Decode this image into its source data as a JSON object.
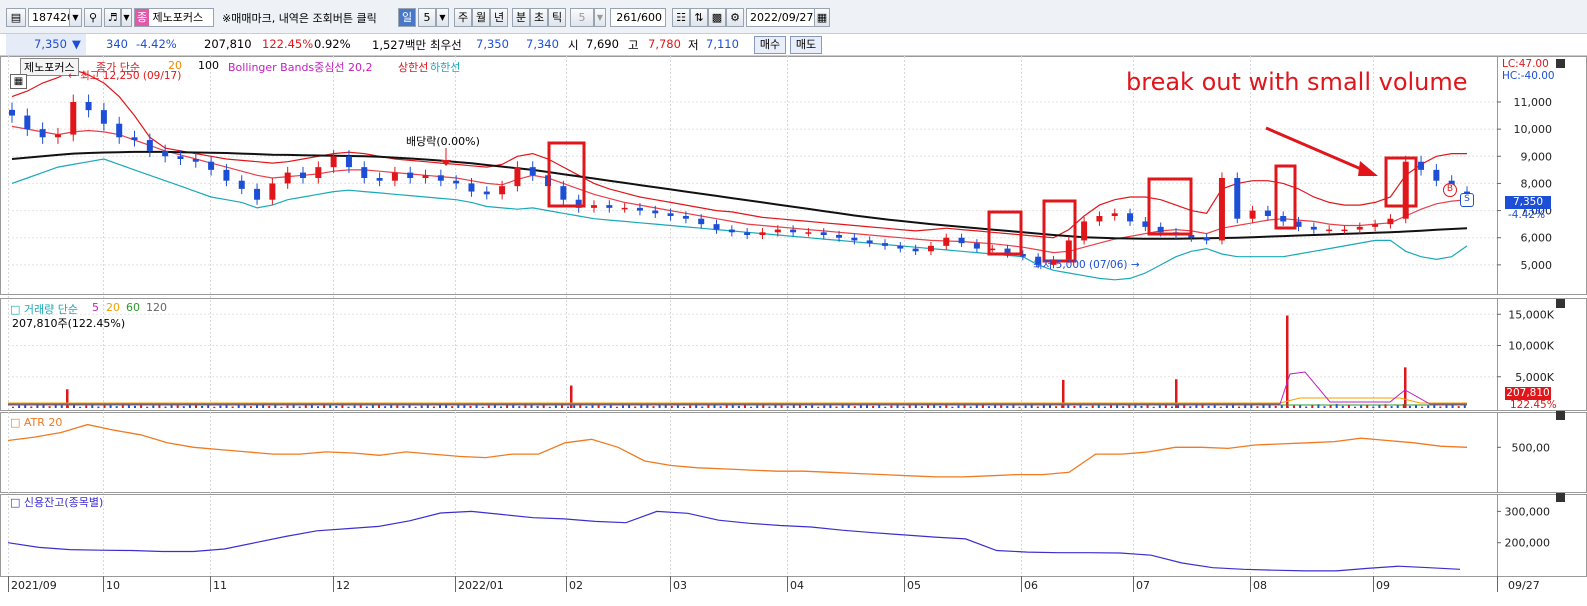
{
  "toolbar": {
    "stock_code": "187420",
    "stock_name_badge": "종",
    "stock_name": "제노포커스",
    "notice": "※매매마크, 내역은 조회버튼 클릭",
    "period_buttons": [
      "일",
      "5",
      "주",
      "월",
      "년",
      "분",
      "초",
      "틱",
      "5"
    ],
    "count": "261/600",
    "date": "2022/09/27"
  },
  "quote": {
    "price": "7,350",
    "change_arrow": "▼",
    "change": "340",
    "change_pct": "-4.42%",
    "volume": "207,810",
    "volume_pct": "122.45%",
    "turnover": "0.92%",
    "amount": "1,527백만",
    "best_label": "최우선",
    "best_ask": "7,350",
    "best_bid": "7,340",
    "open_label": "시",
    "open": "7,690",
    "high_label": "고",
    "high": "7,780",
    "low_label": "저",
    "low": "7,110",
    "buy_label": "매수",
    "sell_label": "매도"
  },
  "price_panel": {
    "stock_tag": "제노포커스",
    "ma_label": "종가 단순",
    "ma_periods": [
      "20",
      "100"
    ],
    "bb_label": "Bollinger Bands중심선 20,2",
    "upper_label": "상한선",
    "lower_label": "하한선",
    "high_marker": "최고 12,250 (09/17)",
    "low_marker": "최저 5,000 (07/06)",
    "dividend_marker": "배당락(0.00%)",
    "annotation": "break out with small volume",
    "lc": "LC:47.00",
    "hc": "HC:-40.00",
    "price_tag": "7,350",
    "price_tag_pct": "-4.42%",
    "signal_b": "B",
    "signal_s": "S"
  },
  "volume_panel": {
    "title": "거래량 단순",
    "periods": [
      "5",
      "20",
      "60",
      "120"
    ],
    "current": "207,810주(122.45%)",
    "tag": "207,810",
    "tag_pct": "122.45%"
  },
  "atr_panel": {
    "title": "ATR 20"
  },
  "credit_panel": {
    "title": "신용잔고(종목별)"
  },
  "x_axis": [
    "2021/09",
    "10",
    "11",
    "12",
    "2022/01",
    "02",
    "03",
    "04",
    "05",
    "06",
    "07",
    "08",
    "09"
  ],
  "x_axis_end": "09/27",
  "colors": {
    "up": "#e0161b",
    "down": "#1d4fd6",
    "ma20": "#e8404a",
    "ma100": "#111111",
    "bb_upper": "#e0161b",
    "bb_lower": "#1aa9b8",
    "atr": "#f07a22",
    "credit": "#3b2fd0",
    "annotation": "#e0161b"
  },
  "chart_data": [
    {
      "type": "candlestick",
      "title": "제노포커스",
      "y_ticks": [
        5000,
        6000,
        7000,
        8000,
        9000,
        10000,
        11000
      ],
      "ylim": [
        4000,
        12400
      ],
      "x_months": [
        "2021/09",
        "10",
        "11",
        "12",
        "2022/01",
        "02",
        "03",
        "04",
        "05",
        "06",
        "07",
        "08",
        "09"
      ],
      "series": [
        {
          "name": "종가",
          "values": [
            10500,
            10000,
            9700,
            9800,
            11000,
            10700,
            10200,
            9700,
            9600,
            9200,
            9000,
            8900,
            8800,
            8500,
            8100,
            7800,
            7400,
            8000,
            8400,
            8200,
            8600,
            9000,
            8600,
            8200,
            8100,
            8400,
            8200,
            8300,
            8100,
            8000,
            7700,
            7600,
            7900,
            8600,
            8300,
            7900,
            7400,
            7100,
            7200,
            7100,
            7100,
            7000,
            6900,
            6800,
            6700,
            6500,
            6300,
            6200,
            6100,
            6200,
            6300,
            6200,
            6200,
            6100,
            6000,
            5900,
            5800,
            5700,
            5600,
            5500,
            5700,
            6000,
            5800,
            5600,
            5600,
            5400,
            5300,
            5000,
            5200,
            5900,
            6600,
            6800,
            6900,
            6600,
            6400,
            6200,
            6100,
            6000,
            5900,
            8200,
            6700,
            7000,
            6800,
            6600,
            6400,
            6300,
            6300,
            6300,
            6400,
            6500,
            6700,
            8800,
            8500,
            8100,
            7700,
            7350
          ]
        },
        {
          "name": "20",
          "values": [
            10100,
            10000,
            9900,
            9800,
            9900,
            9950,
            9900,
            9800,
            9600,
            9400,
            9200,
            9050,
            8900,
            8750,
            8600,
            8450,
            8300,
            8200,
            8250,
            8300,
            8350,
            8450,
            8500,
            8500,
            8450,
            8400,
            8350,
            8300,
            8250,
            8200,
            8100,
            8000,
            7950,
            8150,
            8300,
            8200,
            8000,
            7800,
            7600,
            7450,
            7300,
            7200,
            7100,
            7000,
            6900,
            6800,
            6700,
            6600,
            6500,
            6450,
            6400,
            6350,
            6300,
            6250,
            6200,
            6150,
            6100,
            6050,
            6000,
            5950,
            5900,
            5880,
            5860,
            5820,
            5780,
            5720,
            5650,
            5550,
            5450,
            5500,
            5650,
            5800,
            5950,
            6050,
            6150,
            6250,
            6300,
            6250,
            6150,
            6350,
            6450,
            6550,
            6650,
            6700,
            6650,
            6600,
            6500,
            6450,
            6450,
            6500,
            6550,
            6800,
            7050,
            7250,
            7350,
            7400
          ]
        },
        {
          "name": "100",
          "values": [
            8900,
            8950,
            9000,
            9050,
            9100,
            9120,
            9140,
            9150,
            9160,
            9160,
            9160,
            9150,
            9140,
            9130,
            9120,
            9100,
            9080,
            9060,
            9050,
            9040,
            9030,
            9020,
            9010,
            9000,
            8980,
            8950,
            8920,
            8880,
            8840,
            8790,
            8740,
            8680,
            8620,
            8560,
            8500,
            8420,
            8340,
            8260,
            8180,
            8100,
            8020,
            7940,
            7860,
            7780,
            7700,
            7620,
            7540,
            7460,
            7380,
            7300,
            7220,
            7140,
            7060,
            6980,
            6900,
            6820,
            6750,
            6680,
            6620,
            6560,
            6500,
            6450,
            6400,
            6350,
            6300,
            6250,
            6200,
            6150,
            6100,
            6060,
            6020,
            6000,
            5980,
            5970,
            5960,
            5960,
            5960,
            5970,
            5980,
            5990,
            6000,
            6020,
            6040,
            6060,
            6080,
            6100,
            6120,
            6140,
            6160,
            6180,
            6200,
            6230,
            6260,
            6290,
            6320,
            6350
          ]
        },
        {
          "name": "상한선",
          "values": [
            11200,
            11400,
            11700,
            11900,
            12200,
            12000,
            11700,
            11200,
            10500,
            9700,
            9300,
            9200,
            9100,
            9000,
            8900,
            8850,
            8800,
            8750,
            8800,
            8900,
            9000,
            9100,
            9150,
            9100,
            9000,
            8900,
            8850,
            8800,
            8750,
            8700,
            8650,
            8600,
            8700,
            9000,
            9100,
            8900,
            8600,
            8300,
            8000,
            7800,
            7650,
            7500,
            7400,
            7300,
            7200,
            7100,
            7000,
            6950,
            6850,
            6750,
            6700,
            6650,
            6600,
            6550,
            6500,
            6450,
            6400,
            6350,
            6300,
            6250,
            6300,
            6350,
            6300,
            6250,
            6200,
            6150,
            6100,
            6050,
            6000,
            6300,
            6800,
            7200,
            7400,
            7500,
            7500,
            7400,
            7200,
            7000,
            6900,
            7800,
            8000,
            8100,
            8100,
            8000,
            7800,
            7500,
            7300,
            7200,
            7200,
            7300,
            7500,
            8300,
            8700,
            9000,
            9100,
            9100
          ]
        },
        {
          "name": "하한선",
          "values": [
            8000,
            8200,
            8400,
            8600,
            8700,
            8800,
            8900,
            8700,
            8500,
            8300,
            8100,
            7900,
            7700,
            7500,
            7400,
            7300,
            7100,
            7200,
            7400,
            7500,
            7600,
            7700,
            7750,
            7700,
            7650,
            7600,
            7550,
            7500,
            7450,
            7400,
            7300,
            7150,
            7100,
            7050,
            7100,
            7000,
            6900,
            6800,
            6700,
            6650,
            6600,
            6550,
            6500,
            6450,
            6400,
            6350,
            6300,
            6250,
            6200,
            6150,
            6100,
            6050,
            6000,
            5950,
            5900,
            5850,
            5800,
            5750,
            5700,
            5650,
            5600,
            5550,
            5500,
            5450,
            5400,
            5350,
            5300,
            5000,
            4800,
            4700,
            4600,
            4500,
            4450,
            4500,
            4700,
            5000,
            5300,
            5500,
            5600,
            5400,
            5300,
            5300,
            5300,
            5300,
            5400,
            5500,
            5600,
            5700,
            5800,
            5900,
            5900,
            5500,
            5300,
            5200,
            5300,
            5700
          ]
        }
      ]
    },
    {
      "type": "bar",
      "title": "거래량 단순",
      "y_ticks": [
        5000,
        10000,
        15000
      ],
      "y_tick_labels": [
        "5,000K",
        "10,000K",
        "15,000K"
      ],
      "ylim": [
        0,
        16000
      ],
      "series": [
        {
          "name": "거래량",
          "spikes": [
            {
              "month": "09",
              "value": 3000
            },
            {
              "month": "02",
              "value": 3600
            },
            {
              "month": "06",
              "value": 4500
            },
            {
              "month": "07",
              "value": 4600
            },
            {
              "month": "08",
              "value": 14800
            },
            {
              "month": "09b",
              "value": 6500
            }
          ]
        }
      ]
    },
    {
      "type": "line",
      "title": "ATR 20",
      "y_ticks": [
        500
      ],
      "y_tick_labels": [
        "500,00"
      ],
      "values": [
        530,
        545,
        565,
        600,
        575,
        555,
        520,
        500,
        490,
        480,
        470,
        470,
        480,
        475,
        465,
        480,
        470,
        460,
        455,
        470,
        470,
        520,
        535,
        500,
        440,
        420,
        410,
        405,
        400,
        395,
        395,
        390,
        385,
        380,
        375,
        370,
        370,
        375,
        380,
        380,
        390,
        470,
        470,
        480,
        500,
        500,
        495,
        510,
        515,
        520,
        525,
        540,
        530,
        520,
        505,
        500
      ]
    },
    {
      "type": "line",
      "title": "신용잔고(종목별)",
      "y_ticks": [
        200000,
        300000
      ],
      "y_tick_labels": [
        "200,000",
        "300,000"
      ],
      "values": [
        200000,
        185000,
        178000,
        176000,
        175000,
        172000,
        172000,
        180000,
        200000,
        220000,
        238000,
        245000,
        252000,
        270000,
        295000,
        300000,
        290000,
        280000,
        276000,
        268000,
        264000,
        300000,
        294000,
        272000,
        262000,
        255000,
        250000,
        240000,
        232000,
        225000,
        218000,
        212000,
        175000,
        170000,
        168000,
        168000,
        167000,
        160000,
        135000,
        120000,
        115000,
        112000,
        110000,
        110000,
        118000,
        125000,
        120000,
        115000
      ]
    }
  ]
}
